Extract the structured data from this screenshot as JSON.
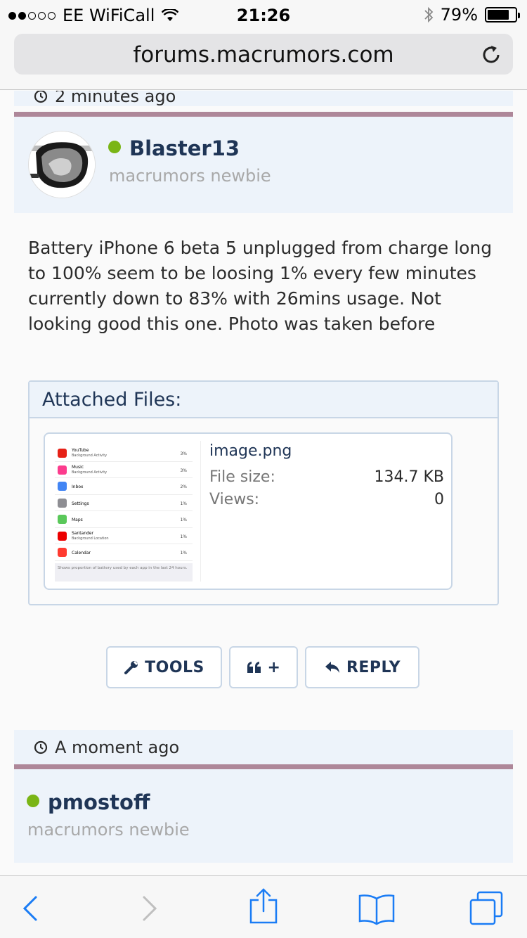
{
  "status_bar": {
    "carrier": "EE WiFiCall",
    "time": "21:26",
    "battery": "79%",
    "battery_level": 0.79
  },
  "browser": {
    "url": "forums.macrumors.com"
  },
  "post1": {
    "timestamp": "2 minutes ago",
    "username": "Blaster13",
    "role": "macrumors newbie",
    "message": "Battery iPhone 6 beta 5 unplugged from charge long to 100% seem to be loosing 1% every few minutes currently down to 83% with 26mins usage. Not looking good this one. Photo was taken before",
    "attachments": {
      "title": "Attached Files:",
      "file": {
        "name": "image.png",
        "size_label": "File size:",
        "size": "134.7 KB",
        "views_label": "Views:",
        "views": "0"
      },
      "thumbnail": {
        "items": [
          {
            "name": "YouTube",
            "sub": "Background Activity",
            "pct": "3%",
            "color": "#e62117"
          },
          {
            "name": "Music",
            "sub": "Background Activity",
            "pct": "3%",
            "color": "#fc3c8d"
          },
          {
            "name": "Inbox",
            "sub": "",
            "pct": "2%",
            "color": "#4285f4"
          },
          {
            "name": "Settings",
            "sub": "",
            "pct": "1%",
            "color": "#8e8e93"
          },
          {
            "name": "Maps",
            "sub": "",
            "pct": "1%",
            "color": "#5ac85a"
          },
          {
            "name": "Santander",
            "sub": "Background Location",
            "pct": "1%",
            "color": "#ec0000"
          },
          {
            "name": "Calendar",
            "sub": "",
            "pct": "1%",
            "color": "#ff3b30"
          }
        ],
        "footer": "Shows proportion of battery used by each app in the last 24 hours."
      }
    },
    "actions": {
      "tools": "TOOLS",
      "quote": "+",
      "reply": "REPLY"
    }
  },
  "post2": {
    "timestamp": "A moment ago",
    "username": "pmostoff",
    "role": "macrumors newbie"
  },
  "colors": {
    "accent": "#1f3556",
    "divider": "#ae8799",
    "online": "#7ab516",
    "ios_blue": "#1a7cf5"
  }
}
